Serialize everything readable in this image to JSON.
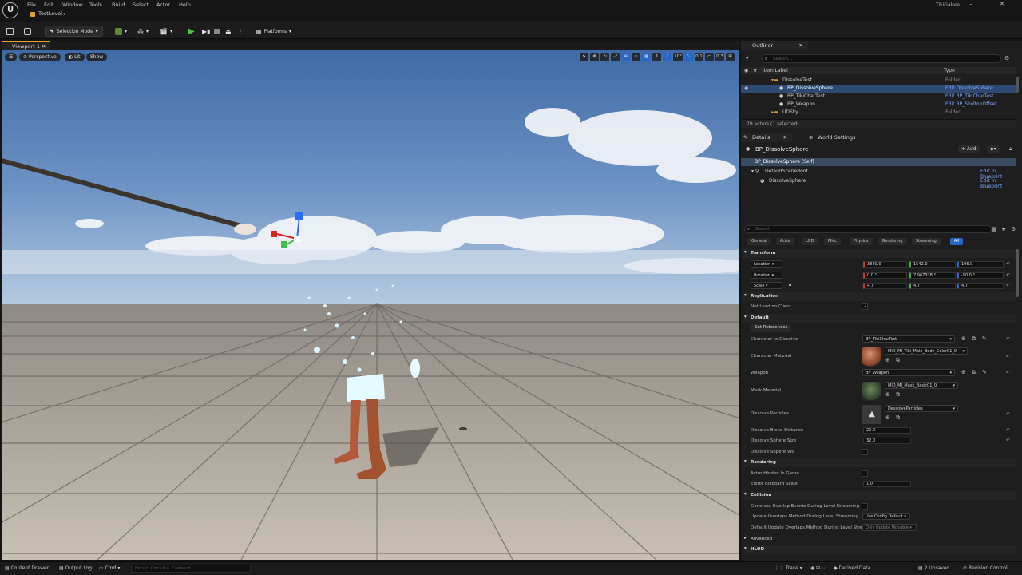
{
  "menu": {
    "items": [
      "File",
      "Edit",
      "Window",
      "Tools",
      "Build",
      "Select",
      "Actor",
      "Help"
    ]
  },
  "window": {
    "level_tab": "TestLevel",
    "project": "TikiGalore",
    "logo": "U"
  },
  "toolbar": {
    "selection_mode": "Selection Mode",
    "platforms": "Platforms"
  },
  "viewport": {
    "tab": "Viewport 1",
    "perspective": "Perspective",
    "lit": "Lit",
    "show": "Show",
    "snap_angle": "10°",
    "snap_scale": "0.1",
    "camera_speed": "0.3",
    "grid_size": "1"
  },
  "outliner": {
    "title": "Outliner",
    "search_placeholder": "Search...",
    "col_label": "Item Label",
    "col_type": "Type",
    "rows": [
      {
        "label": "DissolveTest",
        "type": "Folder"
      },
      {
        "label": "BP_DissolveSphere",
        "type": "Edit DissolveSphere"
      },
      {
        "label": "BP_TikiCharTest",
        "type": "Edit BP_TikiCharTest"
      },
      {
        "label": "BP_Weapon",
        "type": "Edit BP_SkeltonOffset"
      },
      {
        "label": "UDSky",
        "type": "Folder"
      }
    ],
    "count": "79 actors (1 selected)"
  },
  "details": {
    "tab": "Details",
    "tab2": "World Settings",
    "actor": "BP_DissolveSphere",
    "add": "+ Add",
    "self": "BP_DissolveSphere (Self)",
    "comp1": "DefaultSceneRoot",
    "comp2": "DissolveSphere",
    "edit_bp": "Edit in Blueprint",
    "search_placeholder": "Search",
    "cats": [
      "General",
      "Actor",
      "LOD",
      "Misc",
      "Physics",
      "Rendering",
      "Streaming",
      "All"
    ]
  },
  "transform": {
    "title": "Transform",
    "location": {
      "label": "Location",
      "x": "3840.0",
      "y": "1542.0",
      "z": "196.0"
    },
    "rotation": {
      "label": "Rotation",
      "x": "0.0 °",
      "y": "7.967328 °",
      "z": "-90.0 °"
    },
    "scale": {
      "label": "Scale",
      "x": "4.7",
      "y": "4.7",
      "z": "4.7"
    }
  },
  "replication": {
    "title": "Replication",
    "net_load": "Net Load on Client"
  },
  "default": {
    "title": "Default",
    "set_refs": "Set References",
    "char_to_dissolve": "Character to Dissolve",
    "char_value": "BP_TikiCharTest",
    "char_material": "Character Material",
    "char_material_value": "MID_MI_Tiki_Male_Body_Color01_0",
    "weapon": "Weapon",
    "weapon_value": "BP_Weapon",
    "mask_material": "Mask Material",
    "mask_material_value": "MID_MI_Mask_Basic01_0",
    "particles": "Dissolve Particles",
    "particles_value": "DessolveParticles",
    "blend_distance": "Dissolve Blend Distance",
    "blend_value": "20.0",
    "sphere_size": "Dissolve Sphere Size",
    "sphere_value": "32.0",
    "sphere_vis": "Dissolve Shpere Vis"
  },
  "rendering": {
    "title": "Rendering",
    "hidden": "Actor Hidden In Game",
    "billboard": "Editor Billboard Scale",
    "billboard_value": "1.0"
  },
  "collision": {
    "title": "Collision",
    "gen_overlap": "Generate Overlap Events During Level Streaming",
    "upd_overlap": "Update Overlaps Method During Level Streaming",
    "upd_value": "Use Config Default",
    "def_overlap": "Default Update Overlaps Method During Level Stre..",
    "def_value": "Only Update Movable"
  },
  "advanced": "Advanced",
  "hlod": "HLOD",
  "statusbar": {
    "content_drawer": "Content Drawer",
    "output_log": "Output Log",
    "cmd": "Cmd",
    "console_placeholder": "Enter Console Command",
    "trace": "Trace",
    "derived": "Derived Data",
    "unsaved": "2 Unsaved",
    "revision": "Revision Control"
  }
}
